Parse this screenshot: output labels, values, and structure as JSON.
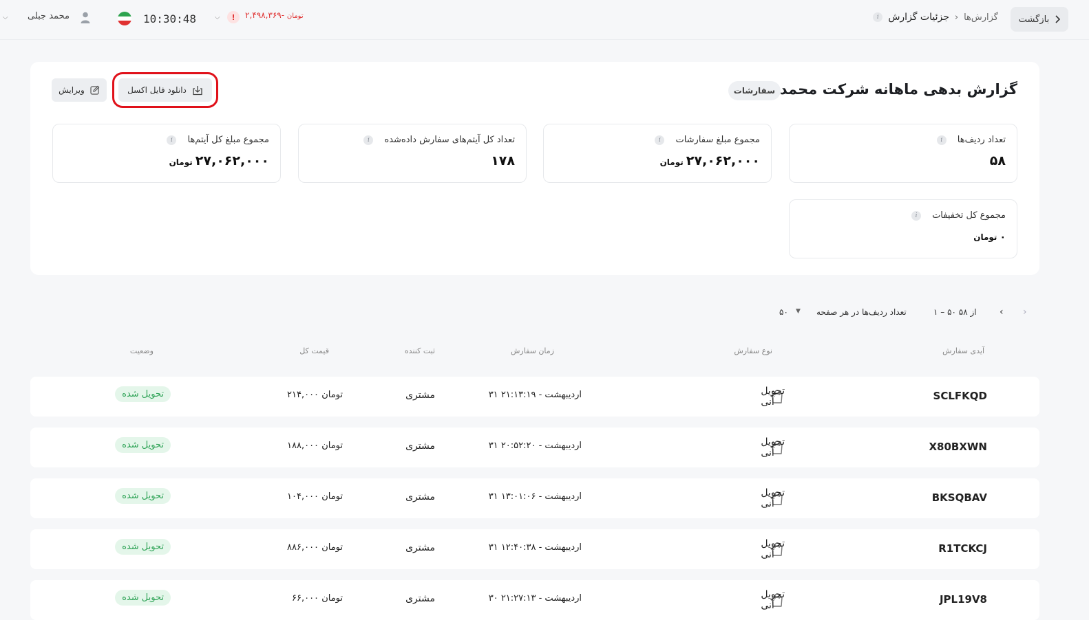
{
  "header": {
    "back_label": "بازگشت",
    "breadcrumb_parent": "گزارش‌ها",
    "breadcrumb_current": "جزئیات گزارش",
    "user_name": "محمد جبلی",
    "clock": "10:30:48",
    "balance_value": "-۲,۴۹۸,۳۶۹",
    "balance_unit": "تومان"
  },
  "report": {
    "title": "گزارش بدهی ماهانه شرکت محمد جبلی",
    "tag": "سفارشات",
    "download_label": "دانلود فایل اکسل",
    "edit_label": "ویرایش"
  },
  "stats": {
    "rows_count": {
      "label": "تعداد ردیف‌ها",
      "value": "۵۸",
      "unit": ""
    },
    "orders_total": {
      "label": "مجموع مبلغ سفارشات",
      "value": "۲۷,۰۶۲,۰۰۰",
      "unit": "تومان"
    },
    "items_count": {
      "label": "تعداد کل آیتم‌های سفارش داده‌شده",
      "value": "۱۷۸",
      "unit": ""
    },
    "items_total": {
      "label": "مجموع مبلغ کل آیتم‌ها",
      "value": "۲۷,۰۶۲,۰۰۰",
      "unit": "تومان"
    },
    "discounts_total": {
      "label": "مجموع کل تخفیفات",
      "value": "۰",
      "unit": "تومان"
    }
  },
  "pagination": {
    "range": "۱ – ۵۰ از ۵۸",
    "per_page_label": "تعداد ردیف‌ها در هر صفحه",
    "per_page_value": "۵۰"
  },
  "table": {
    "headers": {
      "id": "آیدی سفارش",
      "type": "نوع سفارش",
      "time": "زمان سفارش",
      "by": "ثبت کننده",
      "price": "قیمت کل",
      "status": "وضعیت"
    },
    "rows": [
      {
        "id": "SCLFKQD",
        "type": "تحویل آنی",
        "time": "۳۱ اردیبهشت - ۲۱:۱۳:۱۹",
        "by": "مشتری",
        "price": "۲۱۴,۰۰۰ تومان",
        "status": "تحویل شده"
      },
      {
        "id": "X80BXWN",
        "type": "تحویل آنی",
        "time": "۳۱ اردیبهشت - ۲۰:۵۲:۲۰",
        "by": "مشتری",
        "price": "۱۸۸,۰۰۰ تومان",
        "status": "تحویل شده"
      },
      {
        "id": "BKSQBAV",
        "type": "تحویل آنی",
        "time": "۳۱ اردیبهشت - ۱۳:۰۱:۰۶",
        "by": "مشتری",
        "price": "۱۰۴,۰۰۰ تومان",
        "status": "تحویل شده"
      },
      {
        "id": "R1TCKCJ",
        "type": "تحویل آنی",
        "time": "۳۱ اردیبهشت - ۱۲:۴۰:۳۸",
        "by": "مشتری",
        "price": "۸۸۶,۰۰۰ تومان",
        "status": "تحویل شده"
      },
      {
        "id": "JPL19V8",
        "type": "تحویل آنی",
        "time": "۳۰ اردیبهشت - ۲۱:۲۷:۱۳",
        "by": "مشتری",
        "price": "۶۶,۰۰۰ تومان",
        "status": "تحویل شده"
      }
    ]
  },
  "colors": {
    "accent_red": "#e03131",
    "status_green": "#2ea356",
    "highlight_outline": "#e0111a"
  },
  "icons": [
    "chevron-right-icon",
    "info-icon",
    "user-icon",
    "flag-iran-icon",
    "alert-icon",
    "chevron-down-icon",
    "download-icon",
    "edit-icon",
    "shopping-bag-icon",
    "chevron-left-icon"
  ]
}
